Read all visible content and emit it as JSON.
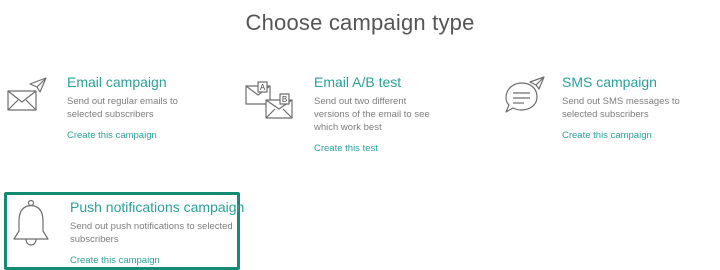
{
  "page": {
    "title": "Choose campaign type"
  },
  "cards": [
    {
      "key": "email",
      "title": "Email campaign",
      "description": "Send out regular emails to selected subscribers",
      "link": "Create this campaign",
      "icon": "envelope-paper-plane-icon"
    },
    {
      "key": "ab",
      "title": "Email A/B test",
      "description": "Send out two different versions of the email to see which work best",
      "link": "Create this test",
      "icon": "envelopes-ab-icon"
    },
    {
      "key": "sms",
      "title": "SMS campaign",
      "description": "Send out SMS messages to selected subscribers",
      "link": "Create this campaign",
      "icon": "speech-bubble-paper-plane-icon"
    },
    {
      "key": "push",
      "title": "Push notifications campaign",
      "description": "Send out push notifications to selected subscribers",
      "link": "Create this campaign",
      "icon": "bell-icon",
      "selected": true
    }
  ],
  "icon_labels": {
    "a": "A",
    "b": "B"
  },
  "colors": {
    "accent": "#2aa19a",
    "selected_border": "#148c74",
    "title": "#555555",
    "body": "#7d7d7d",
    "icon_stroke": "#6e6e6e"
  }
}
